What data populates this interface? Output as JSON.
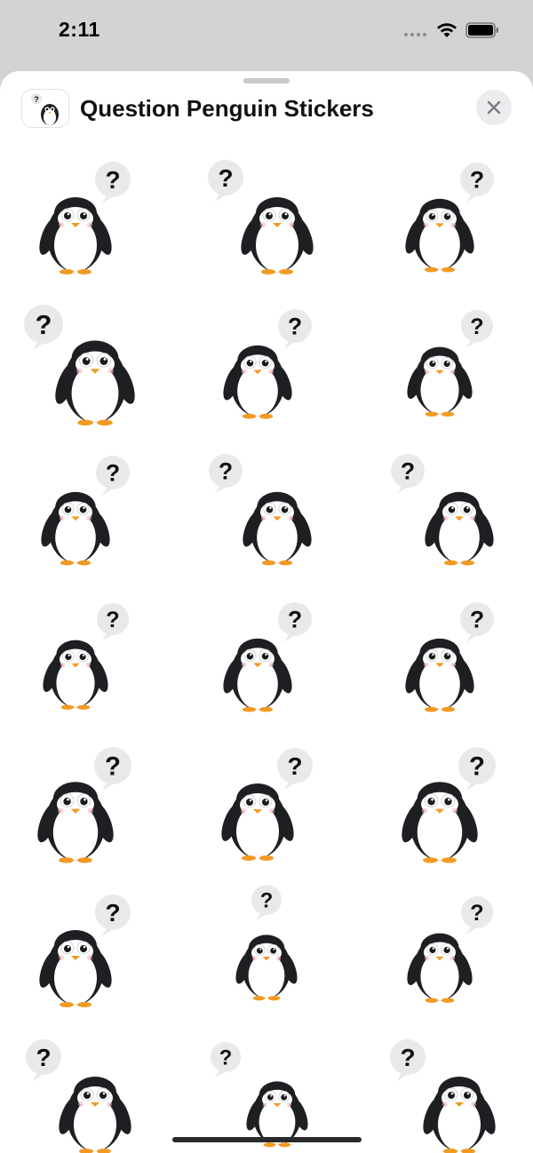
{
  "status_bar": {
    "time": "2:11",
    "wifi_icon": "wifi-icon",
    "battery_icon": "battery-icon"
  },
  "sheet": {
    "title": "Question Penguin Stickers",
    "avatar_icon": "penguin-sticker-avatar",
    "close_icon": "close-icon"
  },
  "stickers": {
    "columns": 3,
    "rows_visible": 7,
    "count_visible": 21,
    "glyph": "?",
    "item_name": "question-penguin-sticker"
  },
  "colors": {
    "sheet_background": "#ffffff",
    "status_background": "#d3d3d3",
    "penguin_body": "#1e1f22",
    "penguin_belly": "#ffffff",
    "beak_feet": "#f39a23",
    "bubble": "#e9e9e9"
  }
}
